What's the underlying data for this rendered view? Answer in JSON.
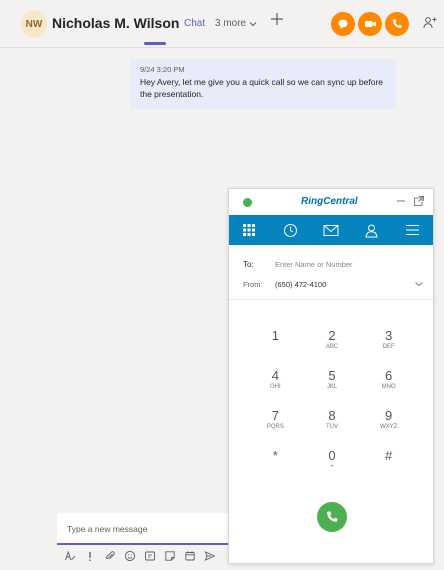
{
  "header": {
    "avatar_initials": "NW",
    "contact_name": "Nicholas M. Wilson",
    "tab_chat": "Chat",
    "tab_more": "3 more",
    "accent_color": "#5b5fc7",
    "call_buttons_color": "#ff8800",
    "icons": [
      "chat-bubble-icon",
      "video-camera-icon",
      "phone-icon",
      "add-people-icon",
      "chevron-down-icon",
      "plus-icon"
    ]
  },
  "message": {
    "timestamp": "9/24 3:20 PM",
    "text": "Hey Avery, let me give you a quick call so we can sync up before the presentation."
  },
  "compose": {
    "placeholder": "Type a new message",
    "tools": [
      "format-icon",
      "priority-icon",
      "attach-icon",
      "emoji-icon",
      "gif-icon",
      "sticker-icon",
      "schedule-meeting-icon",
      "send-icon"
    ]
  },
  "ringcentral": {
    "logo": "RingCentral",
    "status_color": "#4caf50",
    "nav_color": "#0684bd",
    "nav_tabs": [
      "dialpad-icon",
      "history-icon",
      "messages-icon",
      "contacts-icon",
      "menu-icon"
    ],
    "to_label": "To:",
    "to_placeholder": "Enter Name or Number",
    "from_label": "From:",
    "from_value": "(650) 472-4100",
    "keys": [
      {
        "digit": "1",
        "letters": ""
      },
      {
        "digit": "2",
        "letters": "ABC"
      },
      {
        "digit": "3",
        "letters": "DEF"
      },
      {
        "digit": "4",
        "letters": "GHI"
      },
      {
        "digit": "5",
        "letters": "JKL"
      },
      {
        "digit": "6",
        "letters": "MNO"
      },
      {
        "digit": "7",
        "letters": "PQRS"
      },
      {
        "digit": "8",
        "letters": "TUV"
      },
      {
        "digit": "9",
        "letters": "WXYZ"
      },
      {
        "digit": "*",
        "letters": ""
      },
      {
        "digit": "0",
        "letters": "+"
      },
      {
        "digit": "#",
        "letters": ""
      }
    ]
  }
}
